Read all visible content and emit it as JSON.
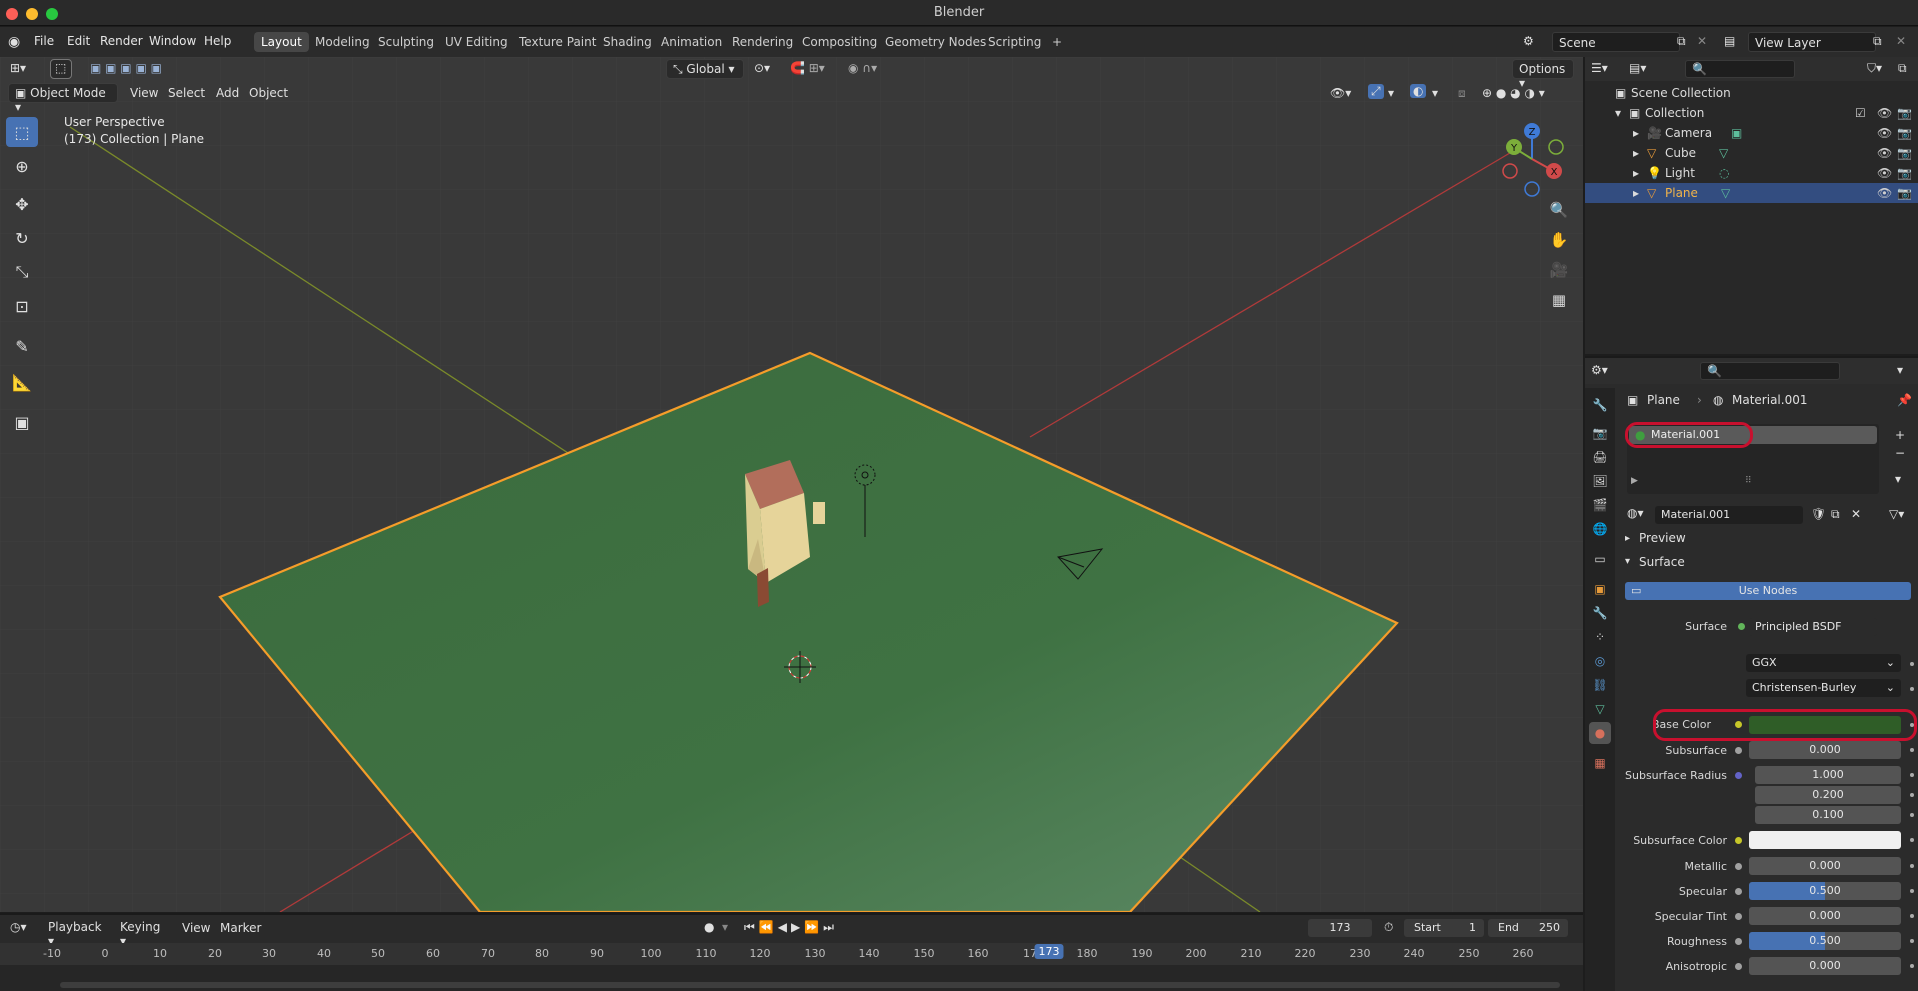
{
  "app": {
    "title": "Blender"
  },
  "menus": [
    "File",
    "Edit",
    "Render",
    "Window",
    "Help"
  ],
  "workspaces": [
    "Layout",
    "Modeling",
    "Sculpting",
    "UV Editing",
    "Texture Paint",
    "Shading",
    "Animation",
    "Rendering",
    "Compositing",
    "Geometry Nodes",
    "Scripting"
  ],
  "active_workspace": "Layout",
  "scene": {
    "name": "Scene",
    "view_layer": "View Layer"
  },
  "viewport": {
    "mode": "Object Mode",
    "menus": [
      "View",
      "Select",
      "Add",
      "Object"
    ],
    "orientation": "Global",
    "options_label": "Options",
    "overlay_title": "User Perspective",
    "overlay_sub": "(173) Collection | Plane",
    "gizmo": {
      "x": "X",
      "y": "Y",
      "z": "Z"
    }
  },
  "outliner": {
    "items": [
      {
        "label": "Scene Collection",
        "icon": "scene-collection-icon"
      },
      {
        "label": "Collection",
        "icon": "collection-icon"
      },
      {
        "label": "Camera",
        "icon": "camera-icon",
        "color": "#e69a3a"
      },
      {
        "label": "Cube",
        "icon": "mesh-icon",
        "color": "#e69a3a"
      },
      {
        "label": "Light",
        "icon": "light-icon",
        "color": "#e69a3a"
      },
      {
        "label": "Plane",
        "icon": "mesh-icon",
        "color": "#e69a3a",
        "selected": true
      }
    ]
  },
  "properties": {
    "breadcrumb": {
      "object": "Plane",
      "material": "Material.001"
    },
    "slot_name": "Material.001",
    "material_name": "Material.001",
    "sections": {
      "preview": "Preview",
      "surface": "Surface"
    },
    "use_nodes": "Use Nodes",
    "surface_label": "Surface",
    "surface_value": "Principled BSDF",
    "distribution": "GGX",
    "subsurface_method": "Christensen-Burley",
    "fields": [
      {
        "label": "Base Color",
        "type": "color",
        "color": "#2f5d27"
      },
      {
        "label": "Subsurface",
        "value": "0.000"
      },
      {
        "label": "Subsurface Radius",
        "values": [
          "1.000",
          "0.200",
          "0.100"
        ]
      },
      {
        "label": "Subsurface Color",
        "type": "color",
        "color": "#f0f0f0"
      },
      {
        "label": "Metallic",
        "value": "0.000"
      },
      {
        "label": "Specular",
        "value": "0.500",
        "fill": 0.5
      },
      {
        "label": "Specular Tint",
        "value": "0.000"
      },
      {
        "label": "Roughness",
        "value": "0.500",
        "fill": 0.5
      },
      {
        "label": "Anisotropic",
        "value": "0.000"
      }
    ]
  },
  "timeline": {
    "menus": [
      "Playback",
      "Keying",
      "View",
      "Marker"
    ],
    "current_frame": "173",
    "start_label": "Start",
    "start": "1",
    "end_label": "End",
    "end": "250",
    "ticks": [
      "-10",
      "0",
      "10",
      "20",
      "30",
      "40",
      "50",
      "60",
      "70",
      "80",
      "90",
      "100",
      "110",
      "120",
      "130",
      "140",
      "150",
      "160",
      "17",
      "173",
      "180",
      "190",
      "200",
      "210",
      "220",
      "230",
      "240",
      "250",
      "260"
    ]
  },
  "colors": {
    "accent": "#4772b3",
    "selection": "#f59d2a",
    "plane": "#3e6e40",
    "highlight_ring": "#c8102e"
  }
}
